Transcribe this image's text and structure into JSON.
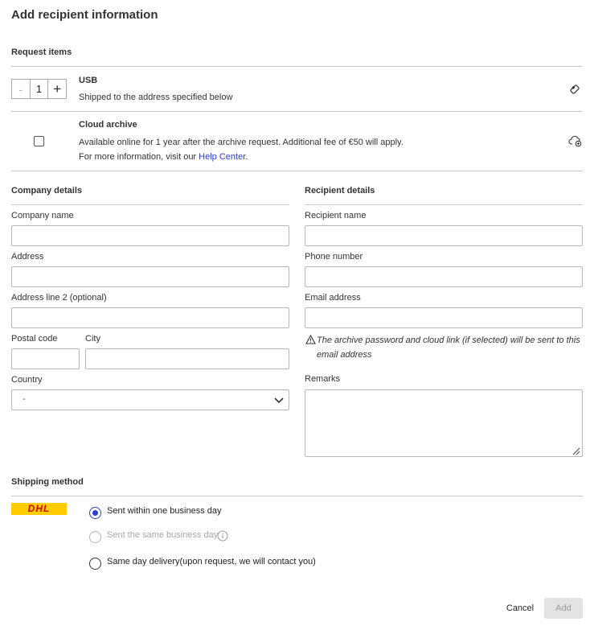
{
  "page": {
    "title": "Add recipient information"
  },
  "request_items": {
    "heading": "Request items",
    "usb": {
      "quantity": "1",
      "minus_symbol": "-",
      "plus_symbol": "+",
      "name": "USB",
      "description": "Shipped to the address specified below",
      "icon": "usb-icon"
    },
    "cloud": {
      "name": "Cloud archive",
      "description": "Available online for 1 year after the archive request. Additional fee of €50 will apply.",
      "more_info_prefix": "For more information, visit our ",
      "help_link": "Help Center",
      "more_info_suffix": ".",
      "checked": false,
      "icon": "cloud-add-icon"
    }
  },
  "company": {
    "heading": "Company details",
    "company_name_label": "Company name",
    "address_label": "Address",
    "address2_label": "Address line 2 (optional)",
    "postal_label": "Postal code",
    "city_label": "City",
    "country_label": "Country",
    "country_value": "-"
  },
  "recipient": {
    "heading": "Recipient details",
    "name_label": "Recipient name",
    "phone_label": "Phone number",
    "email_label": "Email address",
    "email_warning": "The archive password and cloud link (if selected) will be sent to this email address",
    "remarks_label": "Remarks"
  },
  "shipping": {
    "heading": "Shipping method",
    "carrier_logo": "DHL",
    "options": [
      {
        "label": "Sent within one business day",
        "selected": true,
        "disabled": false
      },
      {
        "label": "Sent the same business day",
        "selected": false,
        "disabled": true
      },
      {
        "label": "Same day delivery(upon request, we will contact you)",
        "selected": false,
        "disabled": false
      }
    ]
  },
  "actions": {
    "cancel": "Cancel",
    "add": "Add"
  },
  "colors": {
    "accent": "#2d3ec9",
    "dhl_yellow": "#ffcc00",
    "dhl_red": "#d40511"
  }
}
